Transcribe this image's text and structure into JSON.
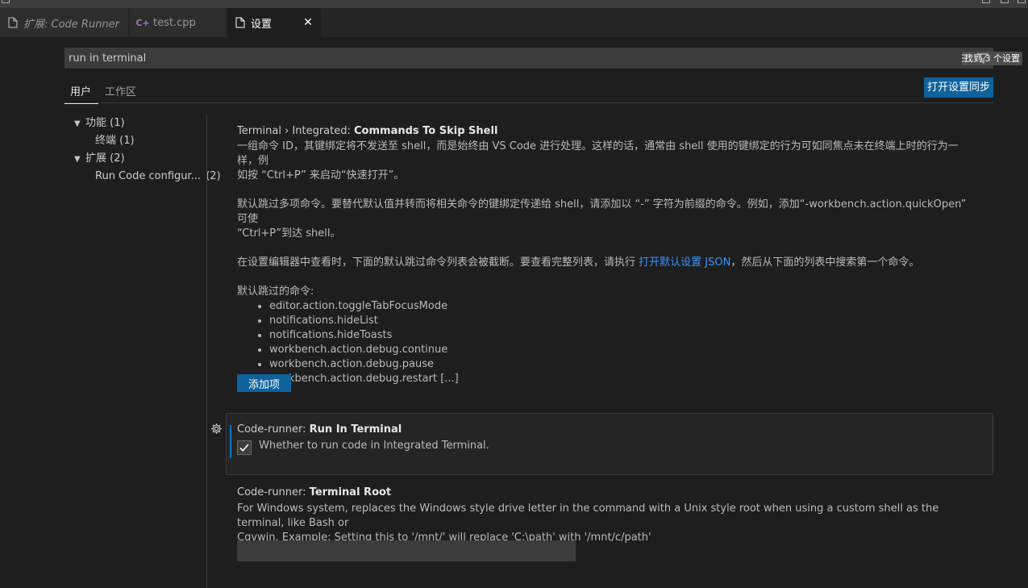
{
  "tab_bar": {
    "tabs": [
      {
        "label": "扩展: Code Runner"
      },
      {
        "label": "test.cpp"
      },
      {
        "label": "设置"
      }
    ]
  },
  "search": {
    "value": "run in terminal",
    "result_badge": "找到 3 个设置"
  },
  "scope_tabs": [
    "用户",
    "工作区"
  ],
  "sync_button": "打开设置同步",
  "toc": {
    "items": [
      {
        "label": "功能",
        "count": "(1)"
      },
      {
        "label": "终端",
        "count": "(1)"
      },
      {
        "label": "扩展",
        "count": "(2)"
      },
      {
        "label": "Run Code configur...",
        "count": "(2)"
      }
    ]
  },
  "settings": {
    "skip_shell": {
      "category": "Terminal › Integrated: ",
      "key": "Commands To Skip Shell",
      "desc1_line1": "一组命令 ID，其键绑定将不发送至 shell，而是始终由 VS Code 进行处理。这样的话，通常由 shell 使用的键绑定的行为可如同焦点未在终端上时的行为一样，例",
      "desc1_line2": "如按 “Ctrl+P” 来启动“快速打开”。",
      "desc2_line1": "默认跳过多项命令。要替代默认值并转而将相关命令的键绑定传递给 shell，请添加以 “-” 字符为前缀的命令。例如，添加“-workbench.action.quickOpen” 可使",
      "desc2_line2": "“Ctrl+P”到达 shell。",
      "desc3_before": "在设置编辑器中查看时，下面的默认跳过命令列表会被截断。要查看完整列表，请执行 ",
      "desc3_link": "打开默认设置 JSON",
      "desc3_after": "，然后从下面的列表中搜索第一个命令。",
      "list_heading": "默认跳过的命令:",
      "commands": [
        "editor.action.toggleTabFocusMode",
        "notifications.hideList",
        "notifications.hideToasts",
        "workbench.action.debug.continue",
        "workbench.action.debug.pause",
        "workbench.action.debug.restart [...]"
      ],
      "add_button": "添加项"
    },
    "run_in_terminal": {
      "category": "Code-runner: ",
      "key": "Run In Terminal",
      "desc": "Whether to run code in Integrated Terminal.",
      "checked": true
    },
    "terminal_root": {
      "category": "Code-runner: ",
      "key": "Terminal Root",
      "desc_line1": "For Windows system, replaces the Windows style drive letter in the command with a Unix style root when using a custom shell as the terminal, like Bash or",
      "desc_line2": "Cgywin. Example: Setting this to '/mnt/' will replace 'C:\\path' with '/mnt/c/path'",
      "value": ""
    }
  },
  "colors": {
    "background": "#1e1e1e",
    "accent_button": "#0e639c",
    "link": "#3794ff",
    "focus_bar": "#007acc"
  }
}
